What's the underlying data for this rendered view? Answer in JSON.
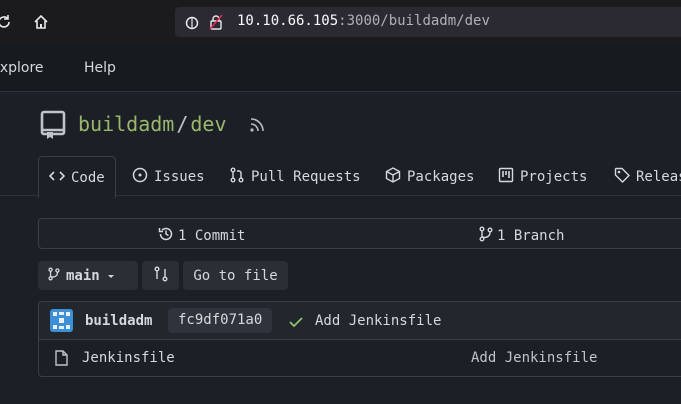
{
  "browser": {
    "url_host": "10.10.66.105",
    "url_path": ":3000/buildadm/dev"
  },
  "site_nav": {
    "explore": "Explore",
    "help": "Help"
  },
  "repo": {
    "owner": "buildadm",
    "separator": "/",
    "name": "dev"
  },
  "tabs": [
    {
      "label": "Code",
      "icon": "code-icon"
    },
    {
      "label": "Issues",
      "icon": "issue-icon"
    },
    {
      "label": "Pull Requests",
      "icon": "pull-request-icon"
    },
    {
      "label": "Packages",
      "icon": "package-icon"
    },
    {
      "label": "Projects",
      "icon": "project-icon"
    },
    {
      "label": "Releas",
      "icon": "tag-icon"
    }
  ],
  "stats": {
    "commits": "1 Commit",
    "branches": "1 Branch"
  },
  "toolbar": {
    "branch": "main",
    "go_to_file": "Go to file"
  },
  "latest_commit": {
    "author": "buildadm",
    "sha": "fc9df071a0",
    "message": "Add Jenkinsfile"
  },
  "files": [
    {
      "name": "Jenkinsfile",
      "commit_message": "Add Jenkinsfile"
    }
  ],
  "colors": {
    "repo_link": "#9ab86c",
    "accent_check": "#8fc36b"
  }
}
